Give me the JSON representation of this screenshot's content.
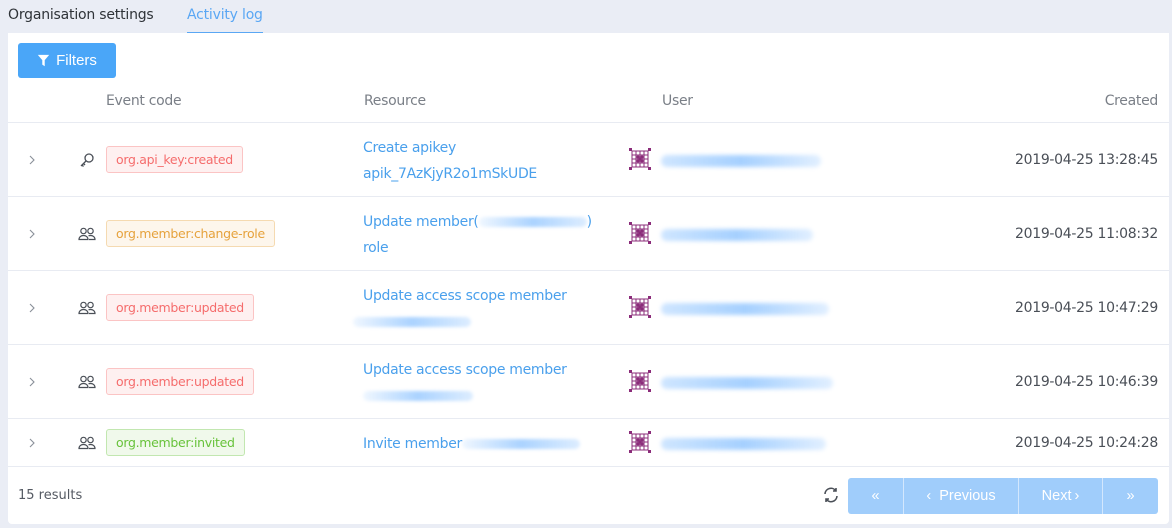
{
  "tabs": [
    {
      "label": "Organisation settings",
      "active": false
    },
    {
      "label": "Activity log",
      "active": true
    }
  ],
  "toolbar": {
    "filters_label": "Filters",
    "filters_icon": "filter-icon"
  },
  "table": {
    "columns": [
      "Event code",
      "Resource",
      "User",
      "Created"
    ],
    "rows": [
      {
        "icon": "key-icon",
        "event_code": "org.api_key:created",
        "badge_color": "red",
        "resource_line1": "Create apikey",
        "resource_line2": "apik_7AzKjyR2o1mSkUDE",
        "user": "[redacted]",
        "created": "2019-04-25 13:28:45"
      },
      {
        "icon": "users-icon",
        "event_code": "org.member:change-role",
        "badge_color": "orange",
        "resource_line1": "Update member(",
        "resource_line1_suffix": ")",
        "resource_line2": "role",
        "user": "[redacted]",
        "created": "2019-04-25 11:08:32"
      },
      {
        "icon": "users-icon",
        "event_code": "org.member:updated",
        "badge_color": "red",
        "resource_line1": "Update access scope member",
        "resource_line2": "",
        "user": "[redacted]",
        "created": "2019-04-25 10:47:29"
      },
      {
        "icon": "users-icon",
        "event_code": "org.member:updated",
        "badge_color": "red",
        "resource_line1": "Update access scope member",
        "resource_line2": "",
        "user": "[redacted]",
        "created": "2019-04-25 10:46:39"
      },
      {
        "icon": "users-icon",
        "event_code": "org.member:invited",
        "badge_color": "green",
        "resource_line1": "Invite member",
        "resource_line2": "",
        "user": "[redacted]",
        "created": "2019-04-25 10:24:28"
      }
    ]
  },
  "footer": {
    "results": "15 results",
    "pager": {
      "first": "«",
      "prev": "Previous",
      "next": "Next",
      "last": "»"
    }
  },
  "colors": {
    "accent": "#4aa6f8",
    "link": "#4aa0ec",
    "avatar": "#8b2c7a"
  }
}
